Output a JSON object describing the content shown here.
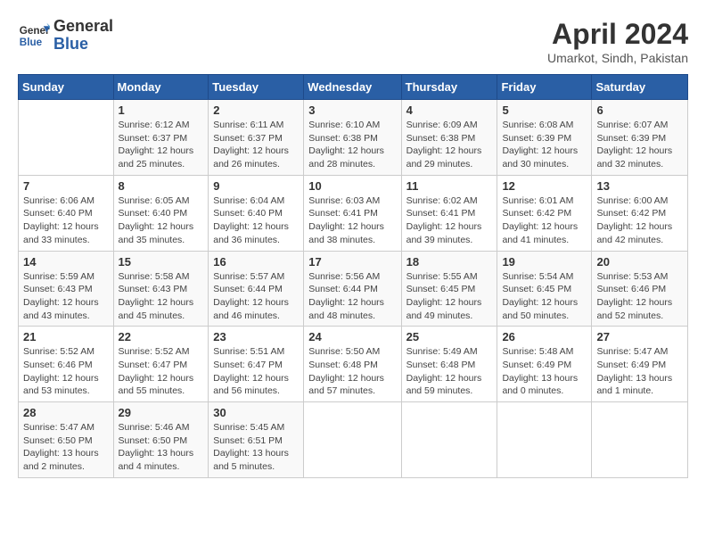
{
  "header": {
    "logo_line1": "General",
    "logo_line2": "Blue",
    "title": "April 2024",
    "subtitle": "Umarkot, Sindh, Pakistan"
  },
  "days_of_week": [
    "Sunday",
    "Monday",
    "Tuesday",
    "Wednesday",
    "Thursday",
    "Friday",
    "Saturday"
  ],
  "weeks": [
    [
      {
        "num": "",
        "info": ""
      },
      {
        "num": "1",
        "info": "Sunrise: 6:12 AM\nSunset: 6:37 PM\nDaylight: 12 hours\nand 25 minutes."
      },
      {
        "num": "2",
        "info": "Sunrise: 6:11 AM\nSunset: 6:37 PM\nDaylight: 12 hours\nand 26 minutes."
      },
      {
        "num": "3",
        "info": "Sunrise: 6:10 AM\nSunset: 6:38 PM\nDaylight: 12 hours\nand 28 minutes."
      },
      {
        "num": "4",
        "info": "Sunrise: 6:09 AM\nSunset: 6:38 PM\nDaylight: 12 hours\nand 29 minutes."
      },
      {
        "num": "5",
        "info": "Sunrise: 6:08 AM\nSunset: 6:39 PM\nDaylight: 12 hours\nand 30 minutes."
      },
      {
        "num": "6",
        "info": "Sunrise: 6:07 AM\nSunset: 6:39 PM\nDaylight: 12 hours\nand 32 minutes."
      }
    ],
    [
      {
        "num": "7",
        "info": "Sunrise: 6:06 AM\nSunset: 6:40 PM\nDaylight: 12 hours\nand 33 minutes."
      },
      {
        "num": "8",
        "info": "Sunrise: 6:05 AM\nSunset: 6:40 PM\nDaylight: 12 hours\nand 35 minutes."
      },
      {
        "num": "9",
        "info": "Sunrise: 6:04 AM\nSunset: 6:40 PM\nDaylight: 12 hours\nand 36 minutes."
      },
      {
        "num": "10",
        "info": "Sunrise: 6:03 AM\nSunset: 6:41 PM\nDaylight: 12 hours\nand 38 minutes."
      },
      {
        "num": "11",
        "info": "Sunrise: 6:02 AM\nSunset: 6:41 PM\nDaylight: 12 hours\nand 39 minutes."
      },
      {
        "num": "12",
        "info": "Sunrise: 6:01 AM\nSunset: 6:42 PM\nDaylight: 12 hours\nand 41 minutes."
      },
      {
        "num": "13",
        "info": "Sunrise: 6:00 AM\nSunset: 6:42 PM\nDaylight: 12 hours\nand 42 minutes."
      }
    ],
    [
      {
        "num": "14",
        "info": "Sunrise: 5:59 AM\nSunset: 6:43 PM\nDaylight: 12 hours\nand 43 minutes."
      },
      {
        "num": "15",
        "info": "Sunrise: 5:58 AM\nSunset: 6:43 PM\nDaylight: 12 hours\nand 45 minutes."
      },
      {
        "num": "16",
        "info": "Sunrise: 5:57 AM\nSunset: 6:44 PM\nDaylight: 12 hours\nand 46 minutes."
      },
      {
        "num": "17",
        "info": "Sunrise: 5:56 AM\nSunset: 6:44 PM\nDaylight: 12 hours\nand 48 minutes."
      },
      {
        "num": "18",
        "info": "Sunrise: 5:55 AM\nSunset: 6:45 PM\nDaylight: 12 hours\nand 49 minutes."
      },
      {
        "num": "19",
        "info": "Sunrise: 5:54 AM\nSunset: 6:45 PM\nDaylight: 12 hours\nand 50 minutes."
      },
      {
        "num": "20",
        "info": "Sunrise: 5:53 AM\nSunset: 6:46 PM\nDaylight: 12 hours\nand 52 minutes."
      }
    ],
    [
      {
        "num": "21",
        "info": "Sunrise: 5:52 AM\nSunset: 6:46 PM\nDaylight: 12 hours\nand 53 minutes."
      },
      {
        "num": "22",
        "info": "Sunrise: 5:52 AM\nSunset: 6:47 PM\nDaylight: 12 hours\nand 55 minutes."
      },
      {
        "num": "23",
        "info": "Sunrise: 5:51 AM\nSunset: 6:47 PM\nDaylight: 12 hours\nand 56 minutes."
      },
      {
        "num": "24",
        "info": "Sunrise: 5:50 AM\nSunset: 6:48 PM\nDaylight: 12 hours\nand 57 minutes."
      },
      {
        "num": "25",
        "info": "Sunrise: 5:49 AM\nSunset: 6:48 PM\nDaylight: 12 hours\nand 59 minutes."
      },
      {
        "num": "26",
        "info": "Sunrise: 5:48 AM\nSunset: 6:49 PM\nDaylight: 13 hours\nand 0 minutes."
      },
      {
        "num": "27",
        "info": "Sunrise: 5:47 AM\nSunset: 6:49 PM\nDaylight: 13 hours\nand 1 minute."
      }
    ],
    [
      {
        "num": "28",
        "info": "Sunrise: 5:47 AM\nSunset: 6:50 PM\nDaylight: 13 hours\nand 2 minutes."
      },
      {
        "num": "29",
        "info": "Sunrise: 5:46 AM\nSunset: 6:50 PM\nDaylight: 13 hours\nand 4 minutes."
      },
      {
        "num": "30",
        "info": "Sunrise: 5:45 AM\nSunset: 6:51 PM\nDaylight: 13 hours\nand 5 minutes."
      },
      {
        "num": "",
        "info": ""
      },
      {
        "num": "",
        "info": ""
      },
      {
        "num": "",
        "info": ""
      },
      {
        "num": "",
        "info": ""
      }
    ]
  ]
}
